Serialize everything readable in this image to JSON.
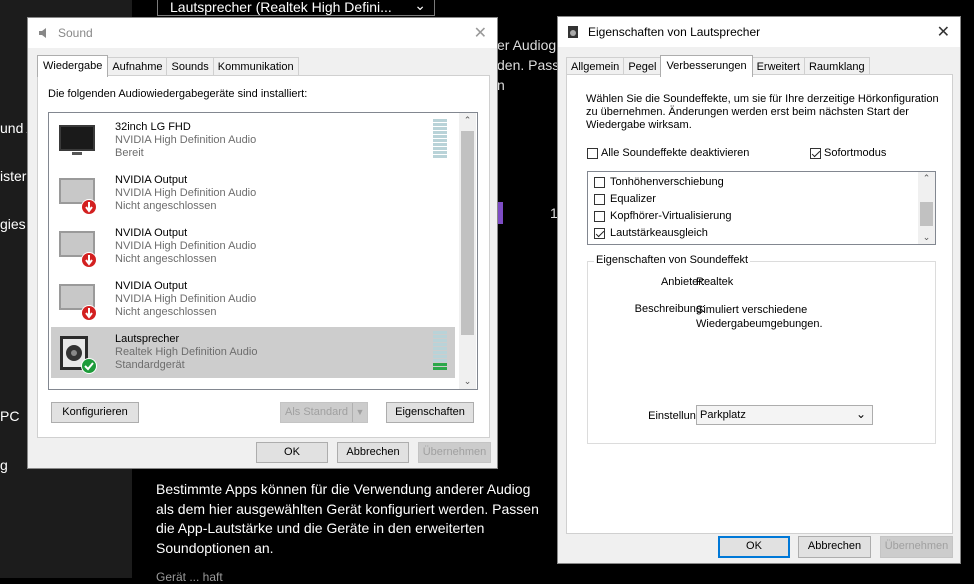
{
  "background": {
    "dropdown_label": "Lautsprecher (Realtek High Defini...",
    "side_items": [
      "und A",
      "ister",
      "gies",
      "PC",
      "g"
    ],
    "text_fragments": [
      "er Audiog",
      "den. Passen",
      "n"
    ],
    "badge": "1",
    "paragraph": [
      "Bestimmte Apps können für die Verwendung anderer Audiog",
      "als dem hier ausgewählten Gerät konfiguriert werden. Passen",
      "die App-Lautstärke und die Geräte in den erweiterten",
      "Soundoptionen an."
    ],
    "link_fragment": "Gerät ... haft"
  },
  "sound_dialog": {
    "title": "Sound",
    "tabs": [
      "Wiedergabe",
      "Aufnahme",
      "Sounds",
      "Kommunikation"
    ],
    "active_tab": "Wiedergabe",
    "heading": "Die folgenden Audiowiedergabegeräte sind installiert:",
    "devices": [
      {
        "name": "32inch LG FHD",
        "driver": "NVIDIA High Definition Audio",
        "status": "Bereit",
        "icon": "monitor-icon",
        "selected": false
      },
      {
        "name": "NVIDIA Output",
        "driver": "NVIDIA High Definition Audio",
        "status": "Nicht angeschlossen",
        "icon": "monitor-disconnected-icon",
        "selected": false
      },
      {
        "name": "NVIDIA Output",
        "driver": "NVIDIA High Definition Audio",
        "status": "Nicht angeschlossen",
        "icon": "monitor-disconnected-icon",
        "selected": false
      },
      {
        "name": "NVIDIA Output",
        "driver": "NVIDIA High Definition Audio",
        "status": "Nicht angeschlossen",
        "icon": "monitor-disconnected-icon",
        "selected": false
      },
      {
        "name": "Lautsprecher",
        "driver": "Realtek High Definition Audio",
        "status": "Standardgerät",
        "icon": "speaker-default-icon",
        "selected": true
      }
    ],
    "buttons": {
      "configure": "Konfigurieren",
      "set_default": "Als Standard",
      "properties": "Eigenschaften",
      "ok": "OK",
      "cancel": "Abbrechen",
      "apply": "Übernehmen"
    }
  },
  "props_dialog": {
    "title": "Eigenschaften von Lautsprecher",
    "tabs": [
      "Allgemein",
      "Pegel",
      "Verbesserungen",
      "Erweitert",
      "Raumklang"
    ],
    "active_tab": "Verbesserungen",
    "description": [
      "Wählen Sie die Soundeffekte, um sie für Ihre derzeitige Hörkonfiguration",
      "zu übernehmen. Änderungen werden erst beim nächsten Start der",
      "Wiedergabe wirksam."
    ],
    "disable_all": {
      "label": "Alle Soundeffekte deaktivieren",
      "checked": false
    },
    "immediate": {
      "label": "Sofortmodus",
      "checked": true
    },
    "effects": [
      {
        "label": "Tonhöhenverschiebung",
        "checked": false
      },
      {
        "label": "Equalizer",
        "checked": false
      },
      {
        "label": "Kopfhörer-Virtualisierung",
        "checked": false
      },
      {
        "label": "Lautstärkeausgleich",
        "checked": true
      }
    ],
    "group_title": "Eigenschaften von Soundeffekt",
    "provider_label": "Anbieter:",
    "provider_value": "Realtek",
    "description_label": "Beschreibung:",
    "description_value": [
      "Simuliert verschiedene",
      "Wiedergabeumgebungen."
    ],
    "setting_label": "Einstellung:",
    "setting_value": "Parkplatz",
    "buttons": {
      "ok": "OK",
      "cancel": "Abbrechen",
      "apply": "Übernehmen"
    }
  }
}
